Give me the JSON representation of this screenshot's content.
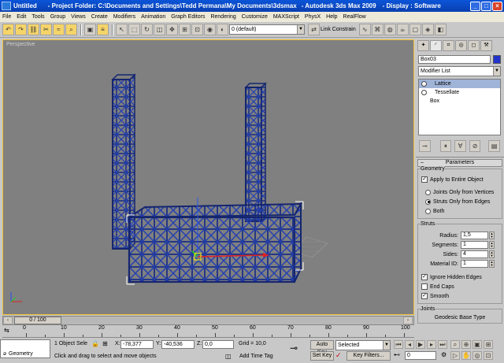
{
  "window": {
    "app_name": "Untitled",
    "title": "- Project Folder: C:\\Documents and Settings\\Tedd Permana\\My Documents\\3dsmax",
    "product": "- Autodesk 3ds Max  2009",
    "display": "- Display : Software"
  },
  "menu": [
    "File",
    "Edit",
    "Tools",
    "Group",
    "Views",
    "Create",
    "Modifiers",
    "Animation",
    "Graph Editors",
    "Rendering",
    "Customize",
    "MAXScript",
    "PhysX",
    "Help",
    "RealFlow"
  ],
  "toolbar": {
    "layer_value": "0 (default)",
    "link_constraint": "Link Constrain"
  },
  "viewport": {
    "label": "Perspective"
  },
  "command_panel": {
    "object_name": "Box03",
    "object_color": "#2233cc",
    "modifier_list_label": "Modifier List",
    "stack": [
      "Lattice",
      "Tessellate",
      "Box"
    ],
    "parameters_title": "Parameters",
    "geometry_label": "Geometry",
    "apply_entire": "Apply to Entire Object",
    "joints_only": "Joints Only from Vertices",
    "struts_only": "Struts Only from Edges",
    "both": "Both",
    "struts_label": "Struts",
    "radius_label": "Radius:",
    "radius_value": "1,5",
    "segments_label": "Segments:",
    "segments_value": "1",
    "sides_label": "Sides:",
    "sides_value": "4",
    "material_label": "Material ID:",
    "material_value": "1",
    "ignore_hidden": "Ignore Hidden Edges",
    "end_caps": "End Caps",
    "smooth": "Smooth",
    "joints_label": "Joints",
    "geodesic_label": "Geodesic Base Type"
  },
  "timeline": {
    "frame": "0 / 100",
    "ticks": [
      "0",
      "10",
      "20",
      "30",
      "40",
      "50",
      "60",
      "70",
      "80",
      "90",
      "100"
    ]
  },
  "status": {
    "script_label": "Geometry",
    "selection": "1 Object Sele",
    "x_label": "X:",
    "x_value": "-78,377",
    "y_label": "Y:",
    "y_value": "-40,536",
    "z_label": "Z:",
    "z_value": "0,0",
    "grid": "Grid = 10,0",
    "prompt": "Click and drag to select and move objects",
    "add_time_tag": "Add Time Tag",
    "auto_key": "Auto Key",
    "selected": "Selected",
    "set_key": "Set Key",
    "key_filters": "Key Filters...",
    "frame_value": "0"
  }
}
